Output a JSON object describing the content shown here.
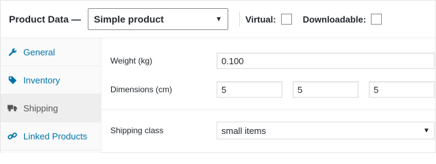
{
  "header": {
    "title": "Product Data —",
    "product_type": "Simple product",
    "virtual_label": "Virtual:",
    "downloadable_label": "Downloadable:"
  },
  "tabs": [
    {
      "label": "General",
      "icon": "wrench-icon",
      "active": false
    },
    {
      "label": "Inventory",
      "icon": "tag-icon",
      "active": false
    },
    {
      "label": "Shipping",
      "icon": "truck-icon",
      "active": true
    },
    {
      "label": "Linked Products",
      "icon": "link-icon",
      "active": false
    }
  ],
  "shipping": {
    "weight_label": "Weight (kg)",
    "weight_value": "0.100",
    "dimensions_label": "Dimensions (cm)",
    "length": "5",
    "width": "5",
    "height": "5",
    "class_label": "Shipping class",
    "class_value": "small items"
  },
  "colors": {
    "link": "#0073aa",
    "active_tab_bg": "#eeeeee",
    "tabs_bg": "#fafafa"
  }
}
